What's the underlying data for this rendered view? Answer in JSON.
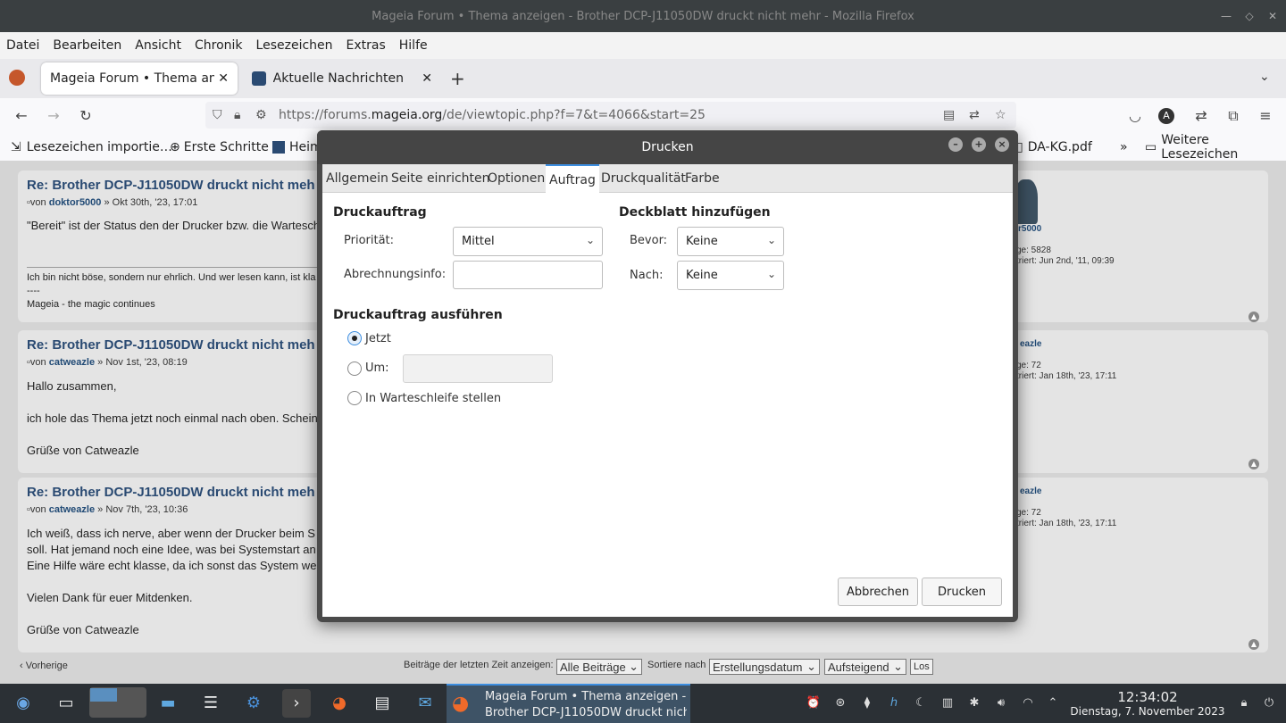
{
  "window": {
    "title": "Mageia Forum • Thema anzeigen - Brother DCP-J11050DW druckt nicht mehr - Mozilla Firefox"
  },
  "menubar": {
    "items": [
      "Datei",
      "Bearbeiten",
      "Ansicht",
      "Chronik",
      "Lesezeichen",
      "Extras",
      "Hilfe"
    ]
  },
  "tabs": [
    {
      "label": "Mageia Forum • Thema anzeig",
      "active": true
    },
    {
      "label": "Aktuelle Nachrichten",
      "active": false
    }
  ],
  "url": {
    "prefix": "https://forums.",
    "domain": "mageia.org",
    "path": "/de/viewtopic.php?f=7&t=4066&start=25"
  },
  "bookmarks": {
    "import": "Lesezeichen importie…",
    "first_steps": "Erste Schritte",
    "heim": "Heim",
    "pdf": "DA-KG.pdf",
    "more": "Weitere Lesezeichen"
  },
  "posts": [
    {
      "title": "Re: Brother DCP-J11050DW druckt nicht meh",
      "by": "von",
      "author": "doktor5000",
      "date": "» Okt 30th, '23, 17:01",
      "text1": "\"Bereit\" ist der Status den der Drucker bzw. die Warteschl",
      "sig1": "Ich bin nicht böse, sondern nur ehrlich. Und wer lesen kann, ist kla",
      "sig2": "----",
      "sig3": "Mageia - the magic continues",
      "profile_name": "r5000",
      "profile_posts": "ge: 5828",
      "profile_reg": "triert: Jun 2nd, '11, 09:39"
    },
    {
      "title": "Re: Brother DCP-J11050DW druckt nicht meh",
      "by": "von",
      "author": "catweazle",
      "date": "» Nov 1st, '23, 08:19",
      "text1": "Hallo zusammen,",
      "text2": "ich hole das Thema jetzt noch einmal nach oben. Schein",
      "text3": "Grüße von Catweazle",
      "profile_name": "eazle",
      "profile_posts": "ge: 72",
      "profile_reg": "triert: Jan 18th, '23, 17:11"
    },
    {
      "title": "Re: Brother DCP-J11050DW druckt nicht meh",
      "by": "von",
      "author": "catweazle",
      "date": "» Nov 7th, '23, 10:36",
      "text1": "Ich weiß, dass ich nerve, aber wenn der Drucker beim S",
      "text2": "soll. Hat jemand noch eine Idee, was bei Systemstart an",
      "text3": "Eine Hilfe wäre echt klasse, da ich sonst das System we",
      "text4": "Vielen Dank für euer Mitdenken.",
      "text5": "Grüße von Catweazle",
      "profile_name": "eazle",
      "profile_posts": "ge: 72",
      "profile_reg": "triert: Jan 18th, '23, 17:11"
    }
  ],
  "bottom": {
    "prev": "Vorherige",
    "filter_label": "Beiträge der letzten Zeit anzeigen:",
    "filter_value": "Alle Beiträge",
    "sort_label": "Sortiere nach",
    "sort_value": "Erstellungsdatum",
    "order_value": "Aufsteigend",
    "go": "Los"
  },
  "dialog": {
    "title": "Drucken",
    "tabs": [
      "Allgemein",
      "Seite einrichten",
      "Optionen",
      "Auftrag",
      "Druckqualität",
      "Farbe"
    ],
    "active_tab": "Auftrag",
    "job_header": "Druckauftrag",
    "priority_label": "Priorität:",
    "priority_value": "Mittel",
    "billing_label": "Abrechnungsinfo:",
    "billing_value": "",
    "cover_header": "Deckblatt hinzufügen",
    "before_label": "Bevor:",
    "before_value": "Keine",
    "after_label": "Nach:",
    "after_value": "Keine",
    "run_header": "Druckauftrag ausführen",
    "radio_now": "Jetzt",
    "radio_at": "Um:",
    "radio_hold": "In Warteschleife stellen",
    "selected_run": "Jetzt",
    "cancel": "Abbrechen",
    "print": "Drucken"
  },
  "taskbar": {
    "active_title_line1": "Mageia Forum • Thema anzeigen -",
    "active_title_line2": "Brother DCP-J11050DW druckt nich…",
    "time": "12:34:02",
    "date": "Dienstag, 7. November 2023"
  },
  "colors": {
    "accent": "#3d8ee0",
    "link": "#2a4a72",
    "taskbar": "#2b3035"
  }
}
